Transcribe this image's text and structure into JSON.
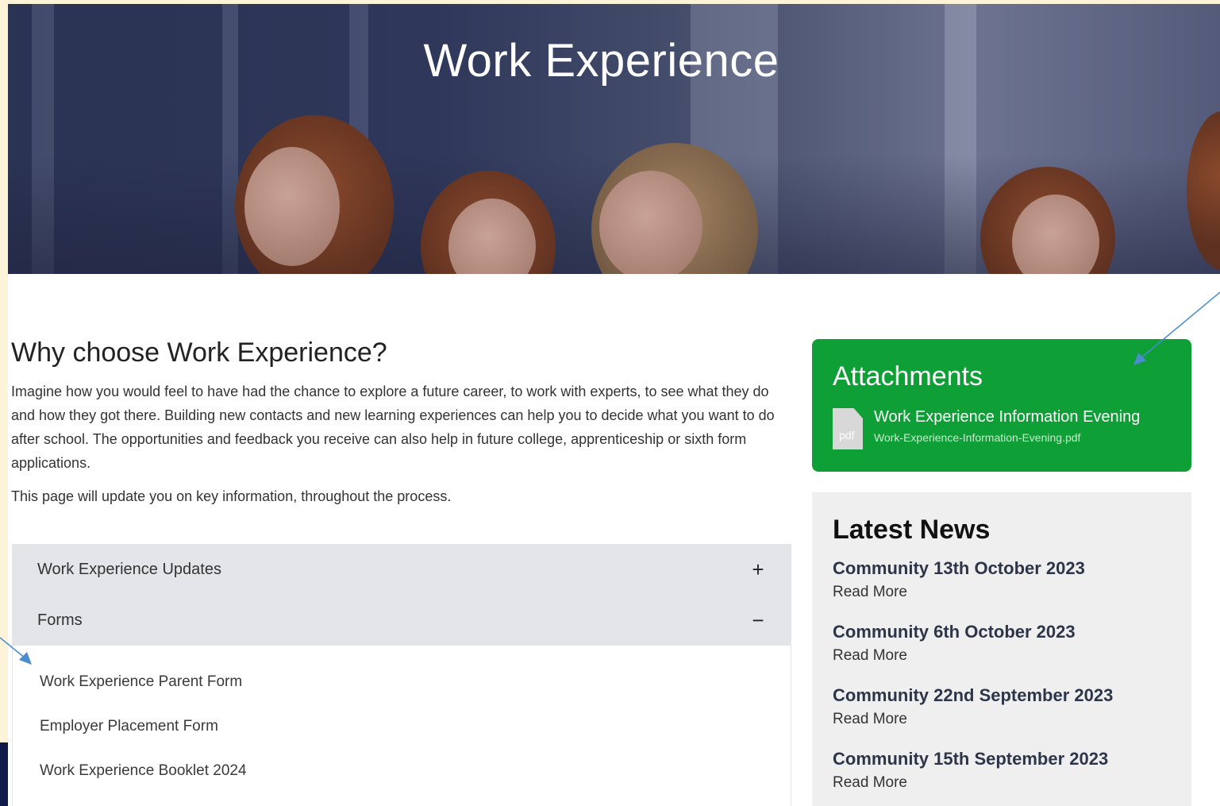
{
  "hero": {
    "title": "Work Experience"
  },
  "main": {
    "heading": "Why choose Work Experience?",
    "intro": "Imagine how you would feel to have had the chance to explore a future career, to work with experts, to see what they do and how they got there. Building new contacts and new learning experiences can help you to decide what you want to do after school. The opportunities and feedback you receive can also help in future college, apprenticeship or sixth form applications.",
    "note": "This page will update you on key information, throughout the process."
  },
  "accordion": {
    "sections": [
      {
        "label": "Work Experience Updates",
        "sign": "+"
      },
      {
        "label": "Forms",
        "sign": "−"
      }
    ],
    "forms_links": [
      "Work Experience Parent Form",
      "Employer Placement Form",
      "Work Experience Booklet 2024"
    ]
  },
  "attachments": {
    "heading": "Attachments",
    "file": {
      "icon_label": "pdf",
      "title": "Work Experience Information Evening",
      "filename": "Work-Experience-Information-Evening.pdf"
    }
  },
  "news": {
    "heading": "Latest News",
    "items": [
      {
        "title": "Community 13th October 2023",
        "more": "Read More"
      },
      {
        "title": "Community 6th October 2023",
        "more": "Read More"
      },
      {
        "title": "Community 22nd September 2023",
        "more": "Read More"
      },
      {
        "title": "Community 15th September 2023",
        "more": "Read More"
      }
    ]
  },
  "colors": {
    "accent_green": "#0e9f36",
    "accordion_bg": "#e3e5e8",
    "hero_navy": "#2b3354",
    "annotation_arrow": "#4a8ccf"
  }
}
